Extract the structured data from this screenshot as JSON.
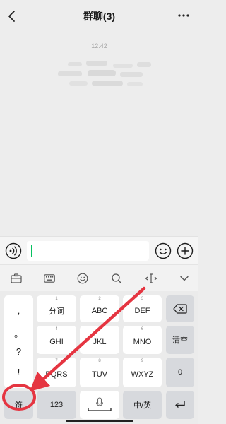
{
  "header": {
    "title": "群聊(3)"
  },
  "chat": {
    "timestamp": "12:42"
  },
  "keyboard": {
    "punct": [
      ",",
      "。",
      "?",
      "!"
    ],
    "keys": [
      {
        "num": "1",
        "label": "分词"
      },
      {
        "num": "2",
        "label": "ABC"
      },
      {
        "num": "3",
        "label": "DEF"
      },
      {
        "num": "4",
        "label": "GHI"
      },
      {
        "num": "5",
        "label": "JKL"
      },
      {
        "num": "6",
        "label": "MNO"
      },
      {
        "num": "7",
        "label": "PQRS"
      },
      {
        "num": "8",
        "label": "TUV"
      },
      {
        "num": "9",
        "label": "WXYZ"
      }
    ],
    "clear_label": "清空",
    "zero_label": "0",
    "symbol_label": "符",
    "num_label": "123",
    "lang_label": "中/英"
  },
  "icons": {
    "back": "chevron-left-icon",
    "more": "more-dots-icon",
    "voice": "voice-icon",
    "emoji": "emoji-icon",
    "plus": "plus-icon",
    "backspace": "backspace-icon",
    "enter": "enter-icon",
    "mic": "mic-icon"
  },
  "colors": {
    "accent": "#07c160",
    "annotation": "#e53541"
  }
}
